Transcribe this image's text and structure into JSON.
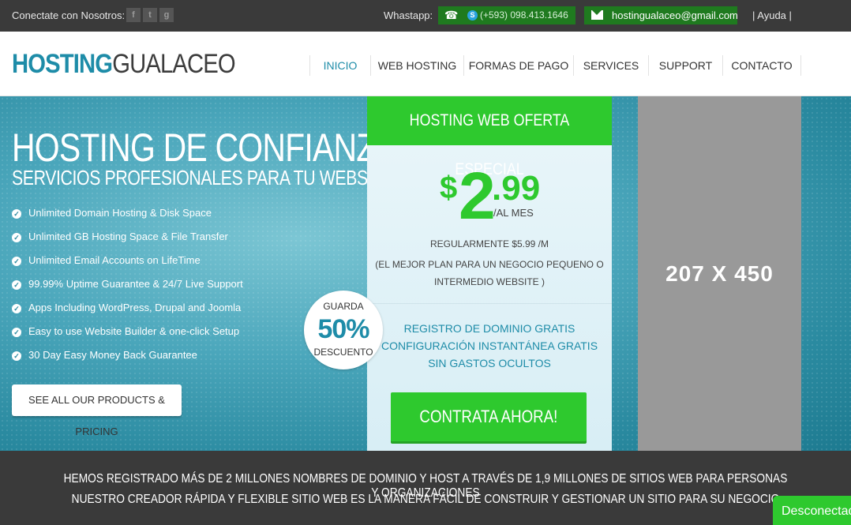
{
  "topbar": {
    "connect_label": "Conectate con Nosotros:",
    "social_icons": [
      "facebook-icon",
      "twitter-icon",
      "google-plus-icon"
    ],
    "whatsapp_label": "Whastapp:",
    "phone": "(+593) 098.413.1646",
    "email": "hostingualaceo@gmail.com",
    "help": "|  Ayuda  |"
  },
  "header": {
    "logo_part1": "HOSTING",
    "logo_part2": "GUALACEO",
    "nav": [
      "INICIO",
      "WEB HOSTING",
      "FORMAS DE PAGO",
      "SERVICES",
      "SUPPORT",
      "CONTACTO"
    ],
    "active_nav": "INICIO"
  },
  "hero": {
    "title": "HOSTING DE CONFIANZA",
    "subtitle": "SERVICIOS PROFESIONALES PARA TU WEBSITE",
    "features": [
      "Unlimited Domain Hosting & Disk Space",
      "Unlimited GB Hosting Space & File Transfer",
      "Unlimited Email Accounts on LifeTime",
      "99.99% Uptime Guarantee & 24/7 Live Support",
      "Apps Including WordPress, Drupal and Joomla",
      "Easy to use Website Builder & one-click Setup",
      "30 Day Easy Money Back Guarantee"
    ],
    "products_button": "SEE ALL OUR PRODUCTS & PRICING"
  },
  "badge": {
    "top": "GUARDA",
    "percent": "50%",
    "bottom": "DESCUENTO"
  },
  "offer": {
    "header": "HOSTING WEB OFERTA ESPECIAL",
    "currency": "$",
    "price_int": "2",
    "price_dec": ".99",
    "period": "/AL MES",
    "regular": "REGULARMENTE $5.99 /M",
    "plan_note": "(EL MEJOR PLAN PARA UN NEGOCIO PEQUENO O INTERMEDIO WEBSITE )",
    "perks": [
      "REGISTRO DE DOMINIO GRATIS",
      "CONFIGURACIÓN INSTANTÁNEA GRATIS",
      "SIN GASTOS OCULTOS"
    ],
    "cta": "CONTRATA AHORA!"
  },
  "ad_placeholder": "207 X 450",
  "band": {
    "line1": "HEMOS REGISTRADO MÁS DE 2 MILLONES NOMBRES DE DOMINIO Y HOST A TRAVÉS DE 1,9 MILLONES DE SITIOS WEB PARA PERSONAS Y ORGANIZACIONES",
    "line2": "NUESTRO CREADOR RÁPIDA Y FLEXIBLE SITIO WEB ES LA MANERA FÁCIL DE CONSTRUIR Y GESTIONAR UN SITIO PARA SU NEGOCIO"
  },
  "chat_button": "Desconectado",
  "colors": {
    "accent_teal": "#1e8ca8",
    "accent_green": "#2ec92e",
    "topbar_bg": "#3a3a3a"
  }
}
